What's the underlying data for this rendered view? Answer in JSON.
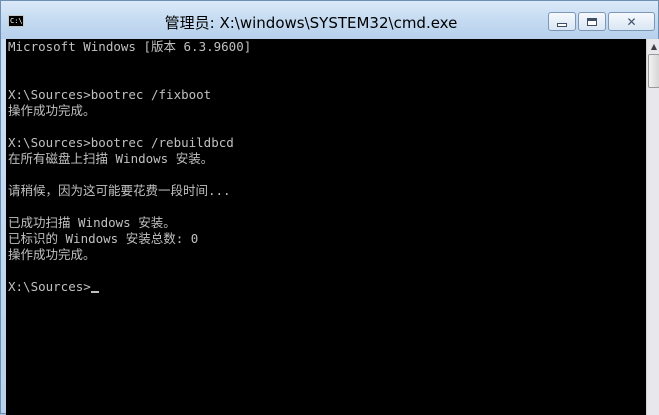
{
  "window": {
    "title": "管理员: X:\\windows\\SYSTEM32\\cmd.exe",
    "icon_text": "C:\\"
  },
  "caption_buttons": {
    "minimize_icon": "minimize-icon",
    "maximize_icon": "maximize-icon",
    "close_icon": "close-icon"
  },
  "console": {
    "lines": [
      "Microsoft Windows [版本 6.3.9600]",
      "",
      "",
      "X:\\Sources>bootrec /fixboot",
      "操作成功完成。",
      "",
      "X:\\Sources>bootrec /rebuildbcd",
      "在所有磁盘上扫描 Windows 安装。",
      "",
      "请稍候，因为这可能要花费一段时间...",
      "",
      "已成功扫描 Windows 安装。",
      "已标识的 Windows 安装总数: 0",
      "操作成功完成。",
      "",
      "X:\\Sources>"
    ]
  },
  "colors": {
    "console_bg": "#000000",
    "console_fg": "#c0c0c0"
  }
}
